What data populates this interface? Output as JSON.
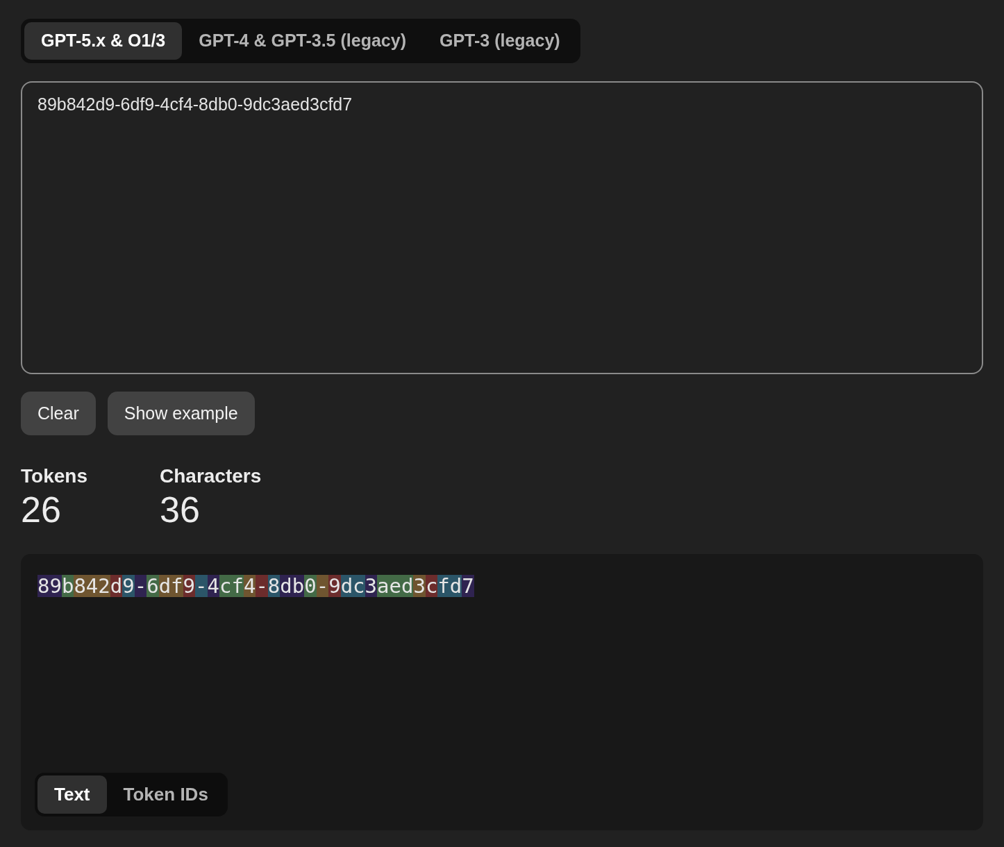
{
  "model_tabs": [
    {
      "label": "GPT-5.x & O1/3",
      "selected": true
    },
    {
      "label": "GPT-4 & GPT-3.5 (legacy)",
      "selected": false
    },
    {
      "label": "GPT-3 (legacy)",
      "selected": false
    }
  ],
  "input": {
    "value": "89b842d9-6df9-4cf4-8db0-9dc3aed3cfd7"
  },
  "buttons": [
    {
      "label": "Clear"
    },
    {
      "label": "Show example"
    }
  ],
  "stats": [
    {
      "label": "Tokens",
      "value": "26"
    },
    {
      "label": "Characters",
      "value": "36"
    }
  ],
  "tokens": [
    {
      "text": "89",
      "color": "#2f2350"
    },
    {
      "text": "b",
      "color": "#436a46"
    },
    {
      "text": "842",
      "color": "#6f5530"
    },
    {
      "text": "d",
      "color": "#6c2c2c"
    },
    {
      "text": "9",
      "color": "#2b5568"
    },
    {
      "text": "-",
      "color": "#2f2350"
    },
    {
      "text": "6",
      "color": "#436a46"
    },
    {
      "text": "df",
      "color": "#6f5530"
    },
    {
      "text": "9",
      "color": "#6c2c2c"
    },
    {
      "text": "-",
      "color": "#2b5568"
    },
    {
      "text": "4",
      "color": "#2f2350"
    },
    {
      "text": "cf",
      "color": "#436a46"
    },
    {
      "text": "4",
      "color": "#6f5530"
    },
    {
      "text": "-",
      "color": "#6c2c2c"
    },
    {
      "text": "8",
      "color": "#2b5568"
    },
    {
      "text": "db",
      "color": "#2f2350"
    },
    {
      "text": "0",
      "color": "#436a46"
    },
    {
      "text": "-",
      "color": "#6f5530"
    },
    {
      "text": "9",
      "color": "#6c2c2c"
    },
    {
      "text": "dc",
      "color": "#2b5568"
    },
    {
      "text": "3",
      "color": "#2f2350"
    },
    {
      "text": "aed",
      "color": "#436a46"
    },
    {
      "text": "3",
      "color": "#6f5530"
    },
    {
      "text": "c",
      "color": "#6c2c2c"
    },
    {
      "text": "fd",
      "color": "#2b5568"
    },
    {
      "text": "7",
      "color": "#2f2350"
    }
  ],
  "view_tabs": [
    {
      "label": "Text",
      "selected": true
    },
    {
      "label": "Token IDs",
      "selected": false
    }
  ]
}
